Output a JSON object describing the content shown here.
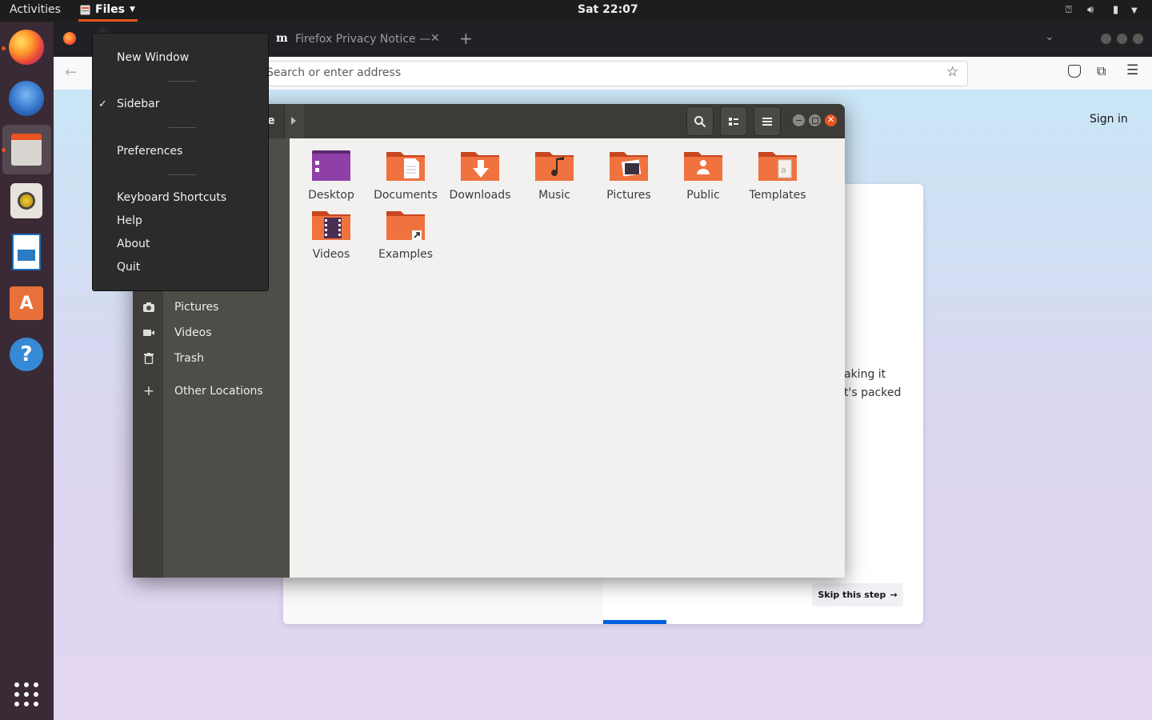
{
  "topbar": {
    "activities": "Activities",
    "app_menu_label": "Files",
    "clock": "Sat 22:07"
  },
  "firefox": {
    "tab_title": "Firefox Privacy Notice —",
    "tab_new": "+",
    "address_placeholder": "Search or enter address",
    "sign_in": "Sign in",
    "card_text_line1": "aking it",
    "card_text_line2": "t's packed",
    "skip_label": "Skip this step",
    "accent": "#0061e0"
  },
  "app_menu": {
    "items": [
      {
        "label": "New Window",
        "checked": false
      },
      {
        "label": "Sidebar",
        "checked": true
      },
      {
        "label": "Preferences",
        "checked": false
      },
      {
        "label": "Keyboard Shortcuts",
        "checked": false
      },
      {
        "label": "Help",
        "checked": false
      },
      {
        "label": "About",
        "checked": false
      },
      {
        "label": "Quit",
        "checked": false
      }
    ],
    "check_glyph": "✓"
  },
  "nautilus": {
    "path_fragment": "e",
    "sidebar": [
      {
        "label": "Pictures",
        "icon": "camera-icon"
      },
      {
        "label": "Videos",
        "icon": "video-icon"
      },
      {
        "label": "Trash",
        "icon": "trash-icon"
      },
      {
        "label": "Other Locations",
        "icon": "plus-icon"
      }
    ],
    "folders": [
      {
        "label": "Desktop",
        "icon": "desktop-folder-icon"
      },
      {
        "label": "Documents",
        "icon": "documents-folder-icon"
      },
      {
        "label": "Downloads",
        "icon": "downloads-folder-icon"
      },
      {
        "label": "Music",
        "icon": "music-folder-icon"
      },
      {
        "label": "Pictures",
        "icon": "pictures-folder-icon"
      },
      {
        "label": "Public",
        "icon": "public-folder-icon"
      },
      {
        "label": "Templates",
        "icon": "templates-folder-icon"
      },
      {
        "label": "Videos",
        "icon": "videos-folder-icon"
      },
      {
        "label": "Examples",
        "icon": "examples-folder-icon"
      }
    ],
    "folder_color": "#e95420"
  },
  "dock": {
    "items": [
      "firefox-icon",
      "thunderbird-icon",
      "files-icon",
      "rhythmbox-icon",
      "writer-icon",
      "software-icon",
      "help-icon",
      "apps-grid-icon"
    ]
  }
}
